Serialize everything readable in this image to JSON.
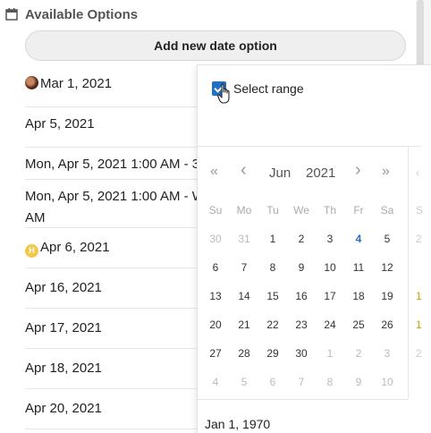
{
  "header": {
    "title": "Available Options",
    "icon": "calendar-icon"
  },
  "add_button": {
    "label": "Add new date option"
  },
  "options": [
    {
      "label": "Mar 1, 2021",
      "avatar": "photo"
    },
    {
      "label": "Apr 5, 2021"
    },
    {
      "label": "Mon, Apr 5, 2021 1:00 AM - 3"
    },
    {
      "label": "Mon, Apr 5, 2021 1:00 AM - W",
      "label2": "AM"
    },
    {
      "label": "Apr 6, 2021",
      "avatar": "H"
    },
    {
      "label": "Apr 16, 2021"
    },
    {
      "label": "Apr 17, 2021"
    },
    {
      "label": "Apr 18, 2021"
    },
    {
      "label": "Apr 20, 2021"
    }
  ],
  "picker": {
    "select_range_label": "Select range",
    "select_range_checked": true,
    "nav": {
      "prev_year": "«",
      "prev_month": "‹",
      "next_month": "›",
      "next_year": "»"
    },
    "month": "Jun",
    "year": "2021",
    "weekdays": [
      "Su",
      "Mo",
      "Tu",
      "We",
      "Th",
      "Fr",
      "Sa"
    ],
    "weeks": [
      [
        "30",
        "31",
        "1",
        "2",
        "3",
        "4",
        "5"
      ],
      [
        "6",
        "7",
        "8",
        "9",
        "10",
        "11",
        "12"
      ],
      [
        "13",
        "14",
        "15",
        "16",
        "17",
        "18",
        "19"
      ],
      [
        "20",
        "21",
        "22",
        "23",
        "24",
        "25",
        "26"
      ],
      [
        "27",
        "28",
        "29",
        "30",
        "1",
        "2",
        "3"
      ],
      [
        "4",
        "5",
        "6",
        "7",
        "8",
        "9",
        "10"
      ]
    ],
    "today": "4",
    "start_date": "Jan 1, 1970",
    "accent_color": "#1f6fc5"
  }
}
